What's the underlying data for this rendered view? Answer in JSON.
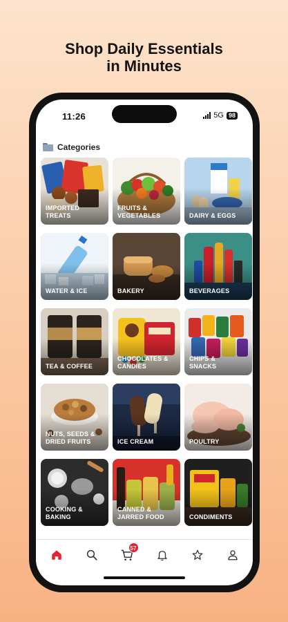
{
  "headline": {
    "line1": "Shop Daily Essentials",
    "line2": "in Minutes"
  },
  "status_bar": {
    "time": "11:26",
    "network": "5G",
    "battery": "98"
  },
  "section_title": "Categories",
  "categories": [
    {
      "label": "IMPORTED\nTREATS",
      "icon": "imported-treats"
    },
    {
      "label": "FRUITS &\nVEGETABLES",
      "icon": "fruits-vegetables"
    },
    {
      "label": "DAIRY & EGGS",
      "icon": "dairy-eggs"
    },
    {
      "label": "WATER & ICE",
      "icon": "water-ice"
    },
    {
      "label": "BAKERY",
      "icon": "bakery"
    },
    {
      "label": "BEVERAGES",
      "icon": "beverages"
    },
    {
      "label": "TEA & COFFEE",
      "icon": "tea-coffee"
    },
    {
      "label": "CHOCOLATES &\nCANDIES",
      "icon": "chocolates-candies"
    },
    {
      "label": "CHIPS &\nSNACKS",
      "icon": "chips-snacks"
    },
    {
      "label": "NUTS, SEEDS &\nDRIED FRUITS",
      "icon": "nuts-seeds"
    },
    {
      "label": "ICE CREAM",
      "icon": "ice-cream"
    },
    {
      "label": "POULTRY",
      "icon": "poultry"
    },
    {
      "label": "COOKING &\nBAKING",
      "icon": "cooking-baking"
    },
    {
      "label": "CANNED &\nJARRED FOOD",
      "icon": "canned-jarred"
    },
    {
      "label": "CONDIMENTS",
      "icon": "condiments"
    }
  ],
  "nav": {
    "items": [
      "home-icon",
      "search-icon",
      "cart-icon",
      "bell-icon",
      "star-icon",
      "user-icon"
    ],
    "cart_count": "57",
    "active_color": "#e3232f"
  },
  "colors": {
    "background": "#fbc9a2",
    "accent": "#e3232f"
  }
}
